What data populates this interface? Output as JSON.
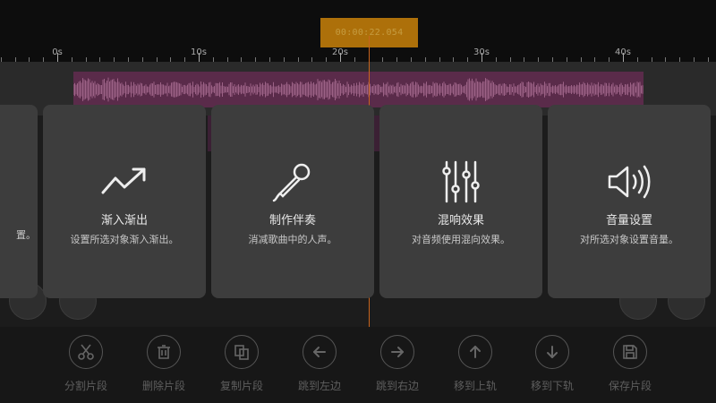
{
  "timecode": "00:00:22.054",
  "ruler": {
    "labels": [
      "0s",
      "10s",
      "20s",
      "30s",
      "40s"
    ]
  },
  "partial_card": {
    "desc_tail": "置。"
  },
  "cards": [
    {
      "icon": "fade-trend-icon",
      "title": "渐入渐出",
      "desc": "设置所选对象渐入渐出。"
    },
    {
      "icon": "microphone-icon",
      "title": "制作伴奏",
      "desc": "消减歌曲中的人声。"
    },
    {
      "icon": "equalizer-sliders-icon",
      "title": "混响效果",
      "desc": "对音频使用混向效果。"
    },
    {
      "icon": "speaker-volume-icon",
      "title": "音量设置",
      "desc": "对所选对象设置音量。"
    }
  ],
  "toolbar": [
    {
      "icon": "scissors-icon",
      "label": "分割片段"
    },
    {
      "icon": "trash-icon",
      "label": "删除片段"
    },
    {
      "icon": "copy-icon",
      "label": "复制片段"
    },
    {
      "icon": "arrow-left-icon",
      "label": "跳到左边"
    },
    {
      "icon": "arrow-right-icon",
      "label": "跳到右边"
    },
    {
      "icon": "arrow-up-icon",
      "label": "移到上轨"
    },
    {
      "icon": "arrow-down-icon",
      "label": "移到下轨"
    },
    {
      "icon": "save-disk-icon",
      "label": "保存片段"
    }
  ],
  "colors": {
    "clip": "#5a2b4a",
    "playhead": "#c8641e",
    "timecode_bg": "#c9820a",
    "card_bg": "#3d3d3d"
  }
}
